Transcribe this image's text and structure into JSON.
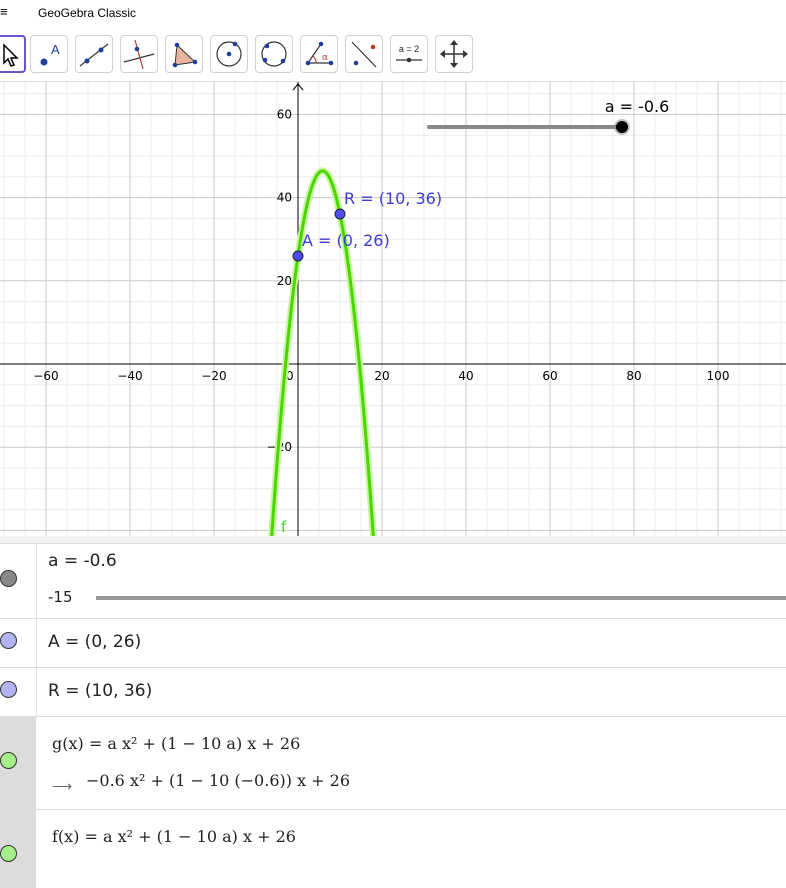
{
  "app": {
    "title": "GeoGebra Classic",
    "menu_icon": "≡"
  },
  "toolbar": {
    "tools": [
      {
        "name": "move-tool-icon",
        "selected": true
      },
      {
        "name": "point-tool-icon",
        "label": "A"
      },
      {
        "name": "line-tool-icon"
      },
      {
        "name": "perpendicular-line-tool-icon"
      },
      {
        "name": "polygon-tool-icon"
      },
      {
        "name": "circle-center-point-tool-icon"
      },
      {
        "name": "circle-three-points-tool-icon"
      },
      {
        "name": "angle-tool-icon",
        "label": "α"
      },
      {
        "name": "reflect-tool-icon"
      },
      {
        "name": "slider-tool-icon",
        "label": "a = 2"
      },
      {
        "name": "move-graphics-view-tool-icon"
      }
    ]
  },
  "graphics": {
    "x_ticks": [
      "−60",
      "−40",
      "−20",
      "0",
      "20",
      "40",
      "60",
      "80",
      "100"
    ],
    "y_ticks": [
      "60",
      "40",
      "20",
      "−20"
    ],
    "point_A_label": "A = (0, 26)",
    "point_R_label": "R = (10, 36)",
    "curve_label": "f",
    "slider_label": "a = -0.6",
    "slider_value": -0.6,
    "slider_min": -15,
    "colors": {
      "curve": "#47d800",
      "curve_glow": "#c8f5a0",
      "point": "#4d4dff",
      "label_blue": "#3b3bd6"
    }
  },
  "algebra": {
    "slider_row": {
      "text": "a = -0.6",
      "min_label": "-15"
    },
    "point_A": "A = (0, 26)",
    "point_R": "R = (10, 36)",
    "g_def": "g(x) = a x² + (1 − 10 a) x + 26",
    "g_value": "−0.6 x² + (1 − 10 (−0.6)) x + 26",
    "f_def": "f(x) = a x² + (1 − 10 a) x + 26",
    "arrow": "⟶"
  }
}
